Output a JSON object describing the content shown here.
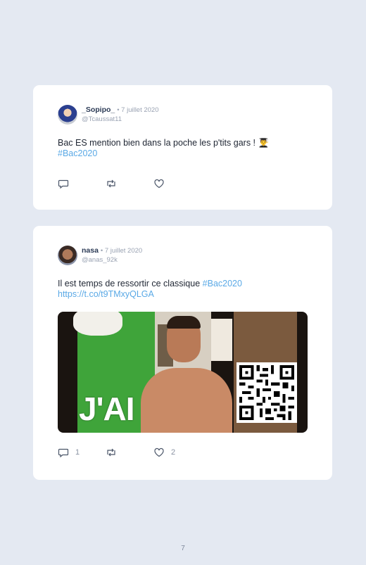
{
  "tweets": [
    {
      "display_name": "_Sopipo_",
      "date": "7 juillet 2020",
      "handle": "@Tcaussat11",
      "text": "Bac ES mention bien dans la poche les p'tits gars ! 👨‍🎓",
      "hashtag": "#Bac2020",
      "replies": "",
      "likes": ""
    },
    {
      "display_name": "nasa",
      "date": "7 juillet 2020",
      "handle": "@anas_92k",
      "text": "Il est temps de ressortir ce classique",
      "hashtag": "#Bac2020",
      "link": "https://t.co/t9TMxyQLGA",
      "media_caption": "J'AI",
      "replies": "1",
      "likes": "2"
    }
  ],
  "page_number": "7",
  "colors": {
    "background": "#e4e9f2",
    "card": "#ffffff",
    "link": "#5aa9e6",
    "name": "#2b3a55",
    "muted": "#9aa3b3"
  },
  "icons": [
    "reply-icon",
    "retweet-icon",
    "like-icon",
    "qr-code-icon"
  ]
}
